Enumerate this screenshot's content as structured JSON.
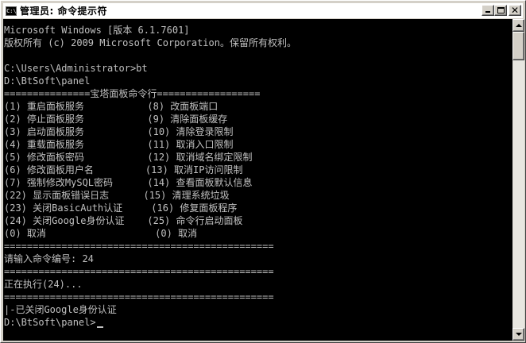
{
  "window": {
    "title": "管理员: 命令提示符",
    "icon": "cmd-icon",
    "buttons": {
      "minimize": "minimize-icon",
      "maximize": "maximize-icon",
      "close": "close-icon",
      "close_glyph": "✕"
    }
  },
  "console": {
    "lines": [
      "Microsoft Windows [版本 6.1.7601]",
      "版权所有 (c) 2009 Microsoft Corporation。保留所有权利。",
      "",
      "C:\\Users\\Administrator>bt",
      "D:\\BtSoft\\panel",
      "===============宝塔面板命令行==================",
      "(1) 重启面板服务           (8) 改面板端口",
      "(2) 停止面板服务           (9) 清除面板缓存",
      "(3) 启动面板服务           (10) 清除登录限制",
      "(4) 重载面板服务           (11) 取消入口限制",
      "(5) 修改面板密码           (12) 取消域名绑定限制",
      "(6) 修改面板用户名         (13) 取消IP访问限制",
      "(7) 强制修改MySQL密码      (14) 查看面板默认信息",
      "(22) 显示面板错误日志      (15) 清理系统垃圾",
      "(23) 关闭BasicAuth认证     (16) 修复面板程序",
      "(24) 关闭Google身份认证    (25) 命令行启动面板",
      "(0) 取消                   (0) 取消",
      "===============================================",
      "请输入命令编号: 24",
      "===============================================",
      "正在执行(24)...",
      "===============================================",
      "|-已关闭Google身份认证",
      "D:\\BtSoft\\panel>"
    ]
  },
  "colors": {
    "console_bg": "#000000",
    "console_text": "#c0c0c0",
    "titlebar_bg": "#ffffff",
    "chrome": "#d4d0c8"
  }
}
